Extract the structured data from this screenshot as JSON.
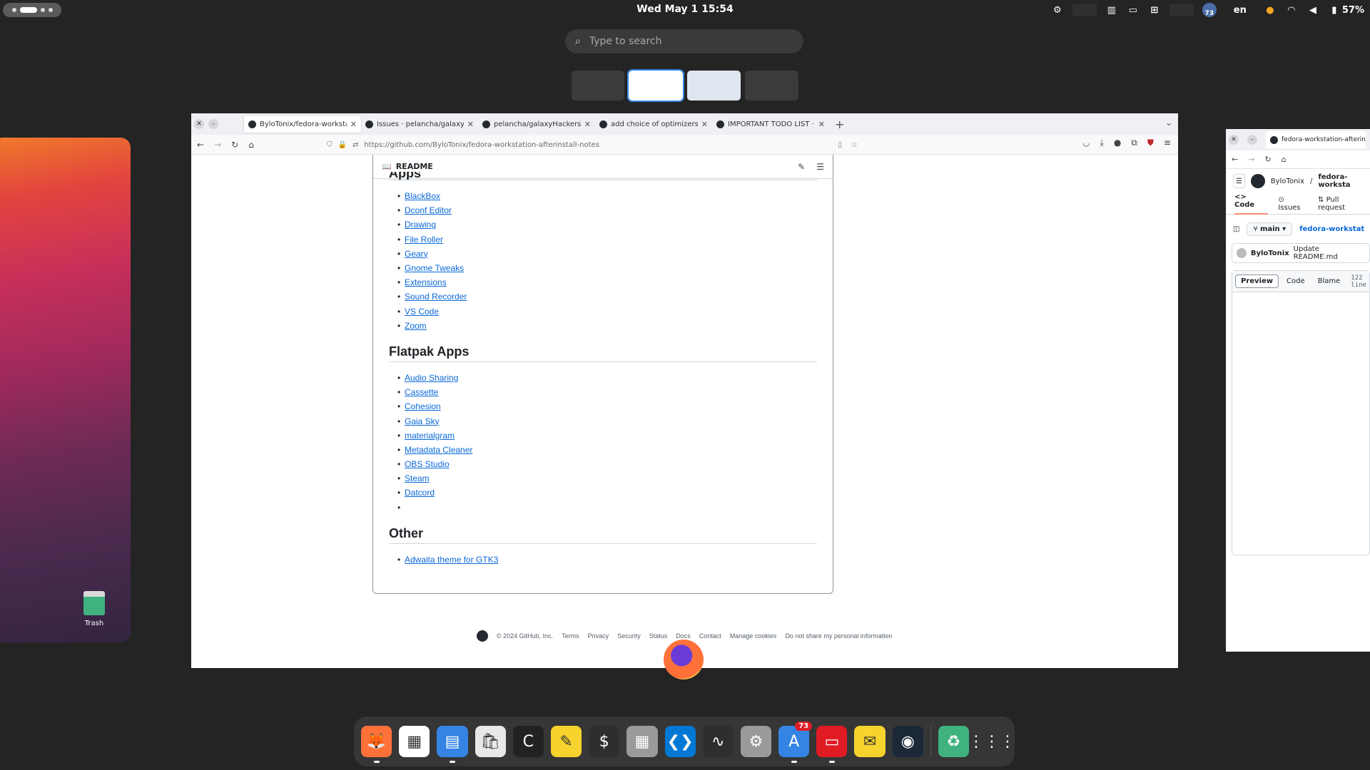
{
  "topbar": {
    "datetime": "Wed May 1  15:54",
    "language": "en",
    "battery": "57%",
    "notification_avatar_count": "73"
  },
  "search": {
    "placeholder": "Type to search"
  },
  "desktop": {
    "trash_label": "Trash"
  },
  "browser": {
    "tabs": [
      {
        "title": "ByloTonix/fedora-workstation"
      },
      {
        "title": "Issues · pelancha/galaxyHack"
      },
      {
        "title": "pelancha/galaxyHackers"
      },
      {
        "title": "add choice of optimizers in m"
      },
      {
        "title": "IMPORTANT TODO LIST · Iss"
      }
    ],
    "url": "https://github.com/ByloTonix/fedora-workstation-afterinstall-notes",
    "readme": {
      "header": "README",
      "sections": [
        {
          "heading": "Apps",
          "items": [
            "BlackBox",
            "Dconf Editor",
            "Drawing",
            "File Roller",
            "Geary",
            "Gnome Tweaks",
            "Extensions",
            "Sound Recorder",
            "VS Code",
            "Zoom"
          ]
        },
        {
          "heading": "Flatpak Apps",
          "items": [
            "Audio Sharing",
            "Cassette",
            "Cohesion",
            "Gaia Sky",
            "materialgram",
            "Metadata Cleaner",
            "OBS Studio",
            "Steam",
            "Datcord",
            ""
          ]
        },
        {
          "heading": "Other",
          "items": [
            "Adwaita theme for GTK3"
          ]
        }
      ]
    },
    "footer": {
      "copyright": "© 2024 GitHub, Inc.",
      "links": [
        "Terms",
        "Privacy",
        "Security",
        "Status",
        "Docs",
        "Contact",
        "Manage cookies",
        "Do not share my personal information"
      ]
    }
  },
  "right_window": {
    "tab_title": "fedora-workstation-afterin",
    "owner": "ByloTonix",
    "slash": "/",
    "repo": "fedora-worksta",
    "nav_tabs": [
      "Code",
      "Issues",
      "Pull request"
    ],
    "branch": "main",
    "repo_link": "fedora-workstat",
    "commit_author": "ByloTonix",
    "commit_message": "Update README.md",
    "view_modes": [
      "Preview",
      "Code",
      "Blame"
    ],
    "lines": "122 line"
  },
  "dock": {
    "apps": [
      {
        "name": "firefox",
        "glyph": "🦊",
        "color": "#ff7139",
        "running": true
      },
      {
        "name": "calendar",
        "glyph": "▦",
        "color": "#ffffff",
        "running": false
      },
      {
        "name": "files",
        "glyph": "▤",
        "color": "#3584e4",
        "running": true
      },
      {
        "name": "software",
        "glyph": "🛍",
        "color": "#e8e8e8",
        "running": false
      },
      {
        "name": "cohesion",
        "glyph": "C",
        "color": "#222222",
        "running": false
      },
      {
        "name": "text-editor",
        "glyph": "✎",
        "color": "#f6d32d",
        "running": false
      },
      {
        "name": "terminal",
        "glyph": "$",
        "color": "#2e2e2e",
        "running": false
      },
      {
        "name": "calculator",
        "glyph": "▦",
        "color": "#9a9a9a",
        "running": false
      },
      {
        "name": "vscode",
        "glyph": "❮❯",
        "color": "#0078d4",
        "running": false
      },
      {
        "name": "system-monitor",
        "glyph": "∿",
        "color": "#2e2e2e",
        "running": false
      },
      {
        "name": "settings",
        "glyph": "⚙",
        "color": "#9a9a9a",
        "running": false
      },
      {
        "name": "app-store",
        "glyph": "A",
        "color": "#3584e4",
        "running": true,
        "badge": "73"
      },
      {
        "name": "cassette",
        "glyph": "▭",
        "color": "#e01b24",
        "running": true
      },
      {
        "name": "mail",
        "glyph": "✉",
        "color": "#f6d32d",
        "running": false
      },
      {
        "name": "steam",
        "glyph": "◉",
        "color": "#1b2838",
        "running": false
      }
    ],
    "trash": {
      "name": "trash",
      "glyph": "♻",
      "color": "#3fb27f"
    },
    "app_grid": {
      "name": "app-grid",
      "glyph": "⋮⋮⋮",
      "color": "#363636"
    }
  }
}
